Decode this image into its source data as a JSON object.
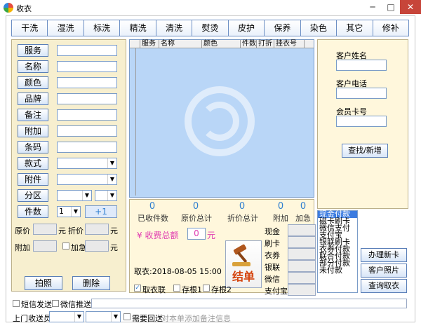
{
  "window": {
    "title": "收衣",
    "min": "─",
    "max": "□",
    "close": "✕"
  },
  "tabs": [
    "干洗",
    "湿洗",
    "标洗",
    "精洗",
    "清洗",
    "熨烫",
    "皮护",
    "保养",
    "染色",
    "其它",
    "修补"
  ],
  "left_panel": {
    "fields": [
      "服务",
      "名称",
      "颜色",
      "品牌",
      "备注",
      "附加",
      "条码"
    ],
    "style_label": "款式",
    "attachment_label": "附件",
    "zone_label": "分区",
    "qty_label": "件数",
    "qty_value": "1",
    "plus_one": "+1",
    "original_price_label": "原价",
    "yuan": "元",
    "discount_label": "折价",
    "extra_label": "附加",
    "urgent_label": "加急",
    "photo_button": "拍照",
    "delete_button": "删除"
  },
  "grid": {
    "columns": [
      "服务",
      "名称",
      "颜色",
      "件数",
      "打折",
      "挂衣号"
    ]
  },
  "totals": {
    "items": [
      {
        "value": "0",
        "label": "已收件数"
      },
      {
        "value": "0",
        "label": "原价总计"
      },
      {
        "value": "0",
        "label": "折价总计"
      },
      {
        "value": "0",
        "label": "附加"
      },
      {
        "value": "0",
        "label": "加急"
      }
    ],
    "fee_label": "¥ 收费总额",
    "fee_value": "0",
    "fee_unit": "元",
    "checkout_button": "结单",
    "pickup_time": "取衣:2018-08-05 15:00",
    "check_pickup": "取衣联",
    "check_stub1": "存根1",
    "check_stub2": "存根2"
  },
  "payment": {
    "methods": [
      "现金",
      "刷卡",
      "衣券",
      "银联",
      "微信",
      "支付宝"
    ],
    "list": [
      "现金付款",
      "磁卡刷卡",
      "微信支付",
      "支付宝",
      "银联刷卡",
      "衣券付款",
      "联合付款",
      "部分付款",
      "未付款"
    ],
    "selected_index": 0
  },
  "customer": {
    "name_label": "客户姓名",
    "phone_label": "客户电话",
    "card_label": "会员卡号",
    "find_button": "查找/新增",
    "new_card_button": "办理新卡",
    "photo_button": "客户照片",
    "query_button": "查询取衣"
  },
  "bottom": {
    "sms_label": "短信发送",
    "wechat_label": "微信推送",
    "courier_label": "上门收送员",
    "need_return_label": "需要回送",
    "note_hint": "对本单添加备注信息"
  },
  "colors": {
    "accent": "#2e7fd0",
    "fee": "#e03bb0",
    "selected": "#3b7be0"
  }
}
